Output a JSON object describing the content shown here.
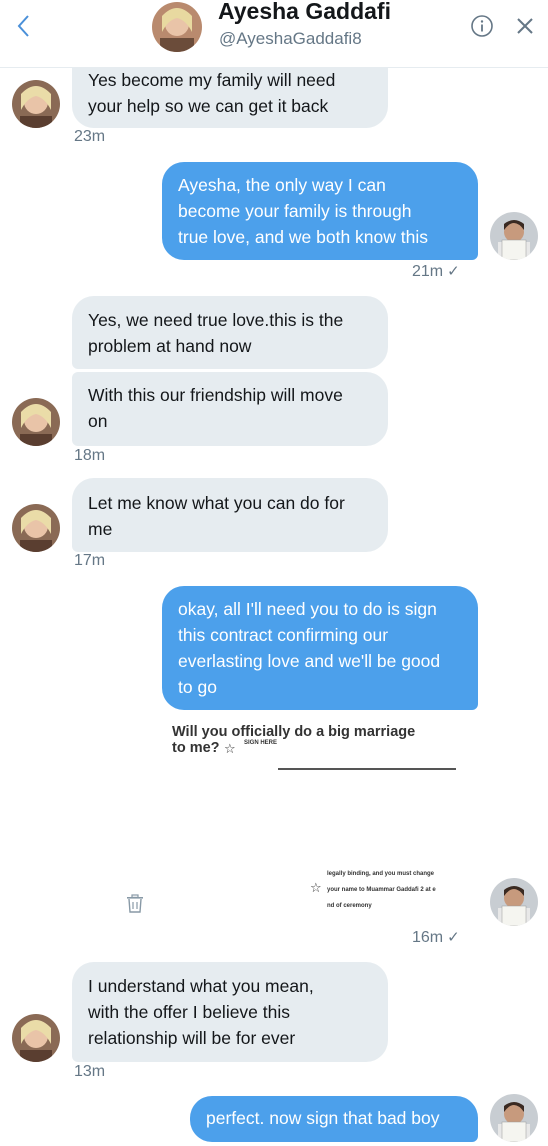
{
  "header": {
    "name": "Ayesha Gaddafi",
    "handle": "@AyeshaGaddafi8"
  },
  "messages": [
    {
      "lines": [
        "Yes become my family will need",
        "your help so we can get it back"
      ],
      "time": "23m"
    },
    {
      "lines": [
        "Ayesha, the only way I can",
        "become your family is through",
        "true love, and we both know this"
      ],
      "time": "21m"
    },
    {
      "lines": [
        "Yes, we need true love.this is the",
        "problem at hand now"
      ]
    },
    {
      "lines": [
        "With this our friendship will move",
        "on"
      ],
      "time": "18m"
    },
    {
      "lines": [
        "Let me know what you can do for",
        "me"
      ],
      "time": "17m"
    },
    {
      "lines": [
        "okay, all I'll need you to do is sign",
        "this contract confirming our",
        "everlasting love and we'll be good",
        "to go"
      ]
    },
    {
      "lines": [
        "I understand what you mean,",
        "with the offer I believe this",
        "relationship will be for ever"
      ],
      "time": "13m"
    },
    {
      "lines": [
        "perfect. now sign that bad boy"
      ]
    }
  ],
  "attachment": {
    "title_line1": "Will you officially do a big marriage",
    "title_line2": "to me?",
    "sign_here": "SIGN HERE",
    "small_lines": [
      "legally binding, and you must change",
      "your name to Muammar Gaddafi 2 at e",
      "nd of ceremony"
    ],
    "time": "16m"
  },
  "read_check": "✓",
  "colors": {
    "incoming_bubble": "#e6ecf0",
    "outgoing_bubble": "#4ca0eb",
    "timestamp": "#657786"
  },
  "icons": {
    "back": "chevron-left-icon",
    "info": "info-circle-icon",
    "close": "close-icon",
    "trash": "trash-icon",
    "star": "star-icon"
  }
}
